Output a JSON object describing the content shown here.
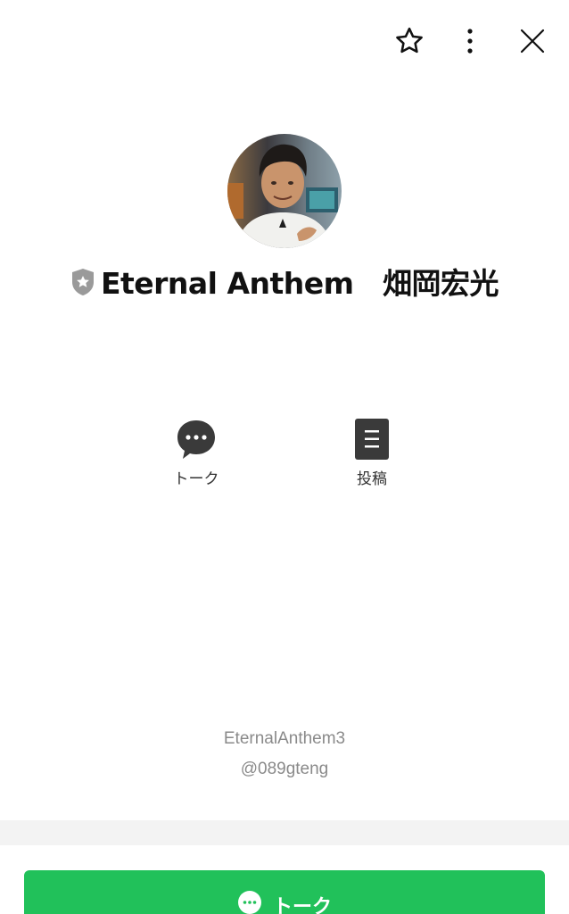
{
  "header": {
    "favorite_icon": "star-icon",
    "more_icon": "more-vertical-icon",
    "close_icon": "close-icon"
  },
  "profile": {
    "name": "Eternal Anthem　畑岡宏光",
    "badge_icon": "shield-star-icon",
    "display_id": "EternalAnthem3",
    "line_id": "@089gteng"
  },
  "actions": [
    {
      "label": "トーク",
      "icon": "chat-bubble-icon"
    },
    {
      "label": "投稿",
      "icon": "document-icon"
    }
  ],
  "footer": {
    "talk_button_label": "トーク",
    "talk_button_icon": "chat-bubble-icon"
  },
  "colors": {
    "accent_green": "#21c15a",
    "badge_gray": "#9a9a9a",
    "icon_dark": "#3a3a3a",
    "divider": "#f3f3f3"
  }
}
